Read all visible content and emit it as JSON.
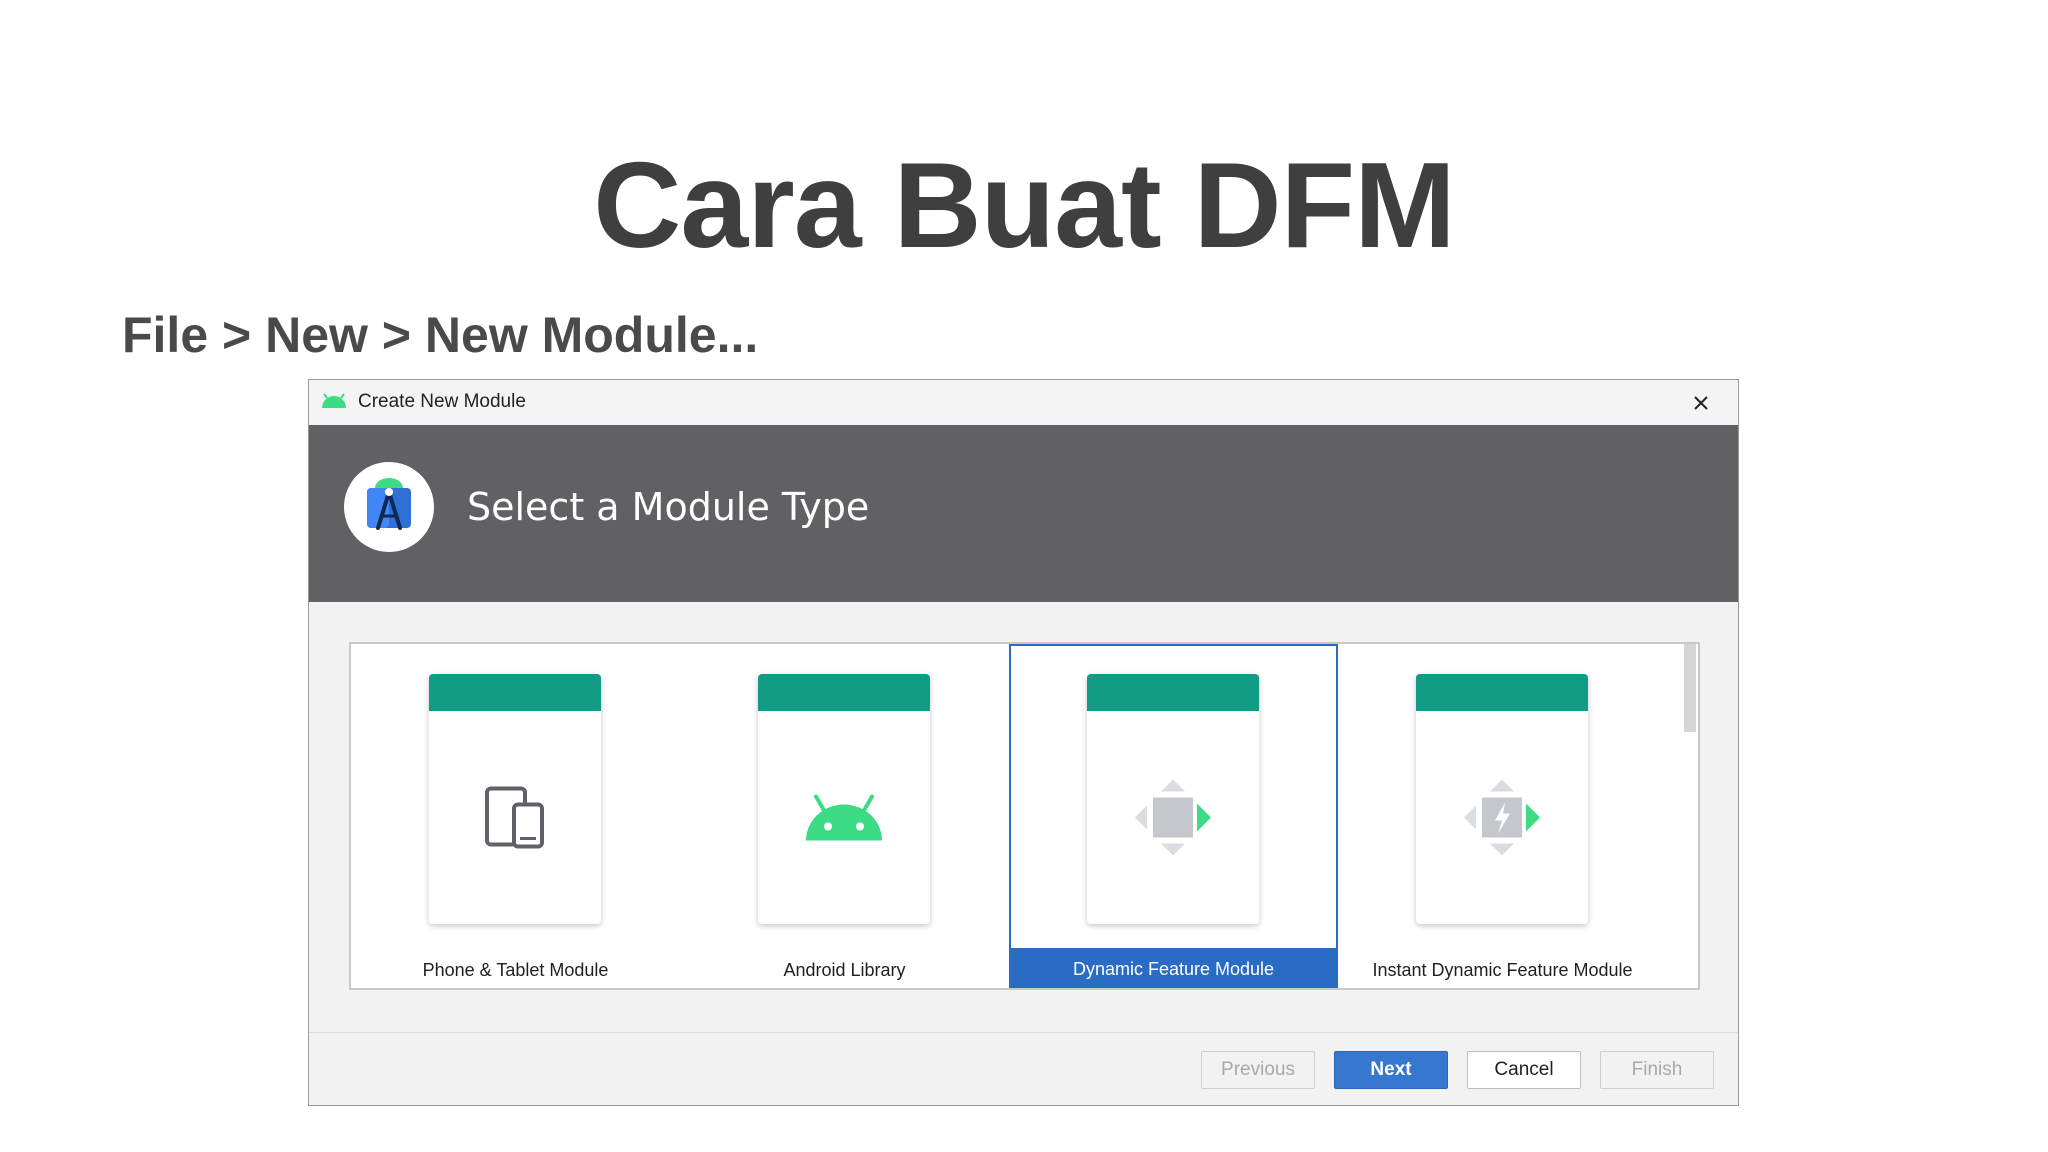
{
  "slide": {
    "title": "Cara Buat DFM",
    "subtitle": "File > New > New Module..."
  },
  "dialog": {
    "window_title": "Create New Module",
    "header_title": "Select a Module Type",
    "module_types": [
      {
        "label": "Phone & Tablet Module",
        "icon": "phone-tablet-icon",
        "selected": false
      },
      {
        "label": "Android Library",
        "icon": "android-icon",
        "selected": false
      },
      {
        "label": "Dynamic Feature Module",
        "icon": "dynamic-feature-icon",
        "selected": true
      },
      {
        "label": "Instant Dynamic Feature Module",
        "icon": "instant-dynamic-feature-icon",
        "selected": false
      }
    ],
    "buttons": {
      "previous": "Previous",
      "next": "Next",
      "cancel": "Cancel",
      "finish": "Finish"
    }
  },
  "colors": {
    "header_bg": "#616163",
    "card_accent": "#109b84",
    "selection": "#2a6cc4",
    "android_green": "#3ddc84",
    "primary_button": "#3677cf"
  }
}
